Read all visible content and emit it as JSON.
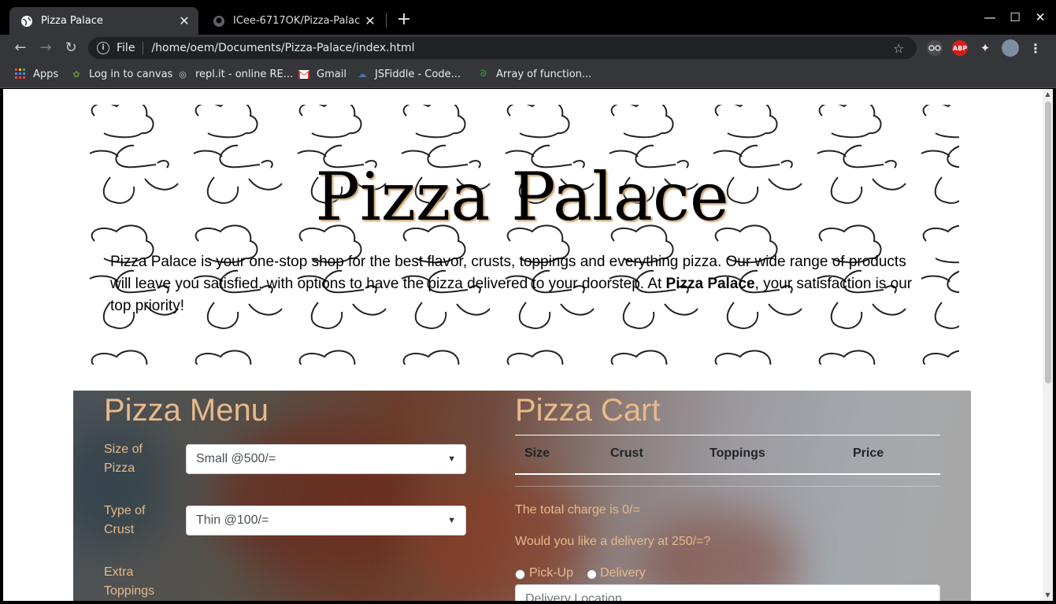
{
  "browser": {
    "tabs": [
      {
        "title": "Pizza Palace",
        "active": true
      },
      {
        "title": "ICee-6717OK/Pizza-Palace",
        "active": false
      }
    ],
    "url_scheme": "File",
    "url": "/home/oem/Documents/Pizza-Palace/index.html",
    "extensions": [
      "ABP"
    ],
    "bookmarks": [
      {
        "label": "Apps",
        "icon": "apps-grid-icon"
      },
      {
        "label": "Log in to canvas",
        "icon": "canvas-icon"
      },
      {
        "label": "repl.it - online RE...",
        "icon": "replit-icon"
      },
      {
        "label": "Gmail",
        "icon": "gmail-icon"
      },
      {
        "label": "JSFiddle - Code...",
        "icon": "jsfiddle-icon"
      },
      {
        "label": "Array of function...",
        "icon": "geeksforgeeks-icon"
      }
    ]
  },
  "hero": {
    "title": "Pizza Palace",
    "intro_before": "Pizza Palace is your one-stop shop for the best flavor, crusts, toppings and everything pizza. Our wide range of products will leave you satisfied, with options to have the pizza delivered to your doorstep. At ",
    "intro_bold": "Pizza Palace",
    "intro_after": ", your satisfaction is our top priority!"
  },
  "menu": {
    "title": "Pizza Menu",
    "size_label": "Size of Pizza",
    "size_value": "Small @500/=",
    "crust_label": "Type of Crust",
    "crust_value": "Thin @100/=",
    "toppings_label": "Extra Toppings"
  },
  "cart": {
    "title": "Pizza Cart",
    "columns": [
      "Size",
      "Crust",
      "Toppings",
      "Price"
    ],
    "total_text": "The total charge is 0/=",
    "delivery_question": "Would you like a delivery at 250/=?",
    "options": [
      "Pick-Up",
      "Delivery"
    ],
    "location_placeholder": "Delivery Location"
  },
  "colors": {
    "accent": "#e7b98a",
    "chrome_bg": "#35363a"
  }
}
